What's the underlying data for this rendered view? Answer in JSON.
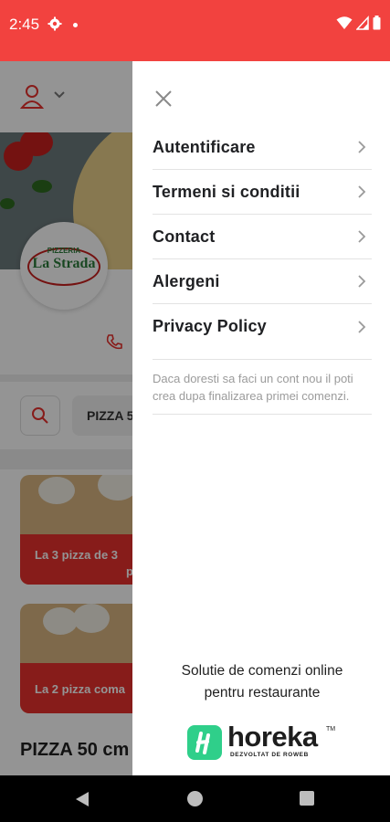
{
  "status_bar": {
    "time": "2:45",
    "icons": [
      "settings-gear-icon",
      "notification-dot-icon",
      "wifi-icon",
      "signal-icon",
      "battery-icon"
    ]
  },
  "background_app": {
    "logo_top": "PIZZERIA",
    "logo_main": "La Strada",
    "search_chip": "PIZZA 5",
    "promos": [
      {
        "label": "La 3 pizza de 3",
        "label_line2": "piz"
      },
      {
        "label": "La 2 pizza coma",
        "label_line2": ""
      }
    ],
    "section_title": "PIZZA 50 cm"
  },
  "drawer": {
    "menu": [
      {
        "label": "Autentificare"
      },
      {
        "label": "Termeni si conditii"
      },
      {
        "label": "Contact"
      },
      {
        "label": "Alergeni"
      },
      {
        "label": "Privacy Policy"
      }
    ],
    "info_text": "Daca doresti sa faci un cont nou il poti crea dupa finalizarea primei comenzi.",
    "footer_line1": "Solutie de comenzi online",
    "footer_line2": "pentru restaurante",
    "brand_name": "horeka",
    "brand_tm": "TM",
    "brand_sub": "DEZVOLTAT DE ROWEB"
  },
  "colors": {
    "status_bar": "#f2423f",
    "accent_red": "#e8312d",
    "brand_green": "#2fcf8a",
    "menu_text": "#202124"
  }
}
